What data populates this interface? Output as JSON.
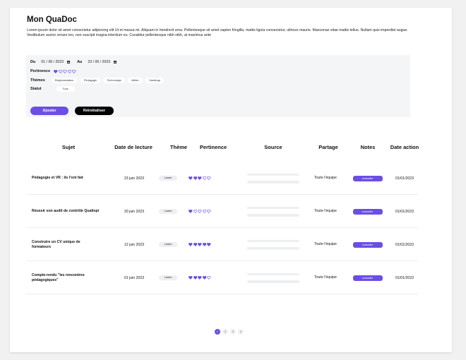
{
  "header": {
    "title": "Mon QuaDoc",
    "description": "Lorem ipsum dolor sit amet consectetur adipiscing elit Ut et massa mi. Aliquam in hendrerit urna. Pellentesque sit amet sapien fringilla, mattis ligula consectetur, ultrices mauris. Maecenas vitae mattis tellus. Nullam quis imperdiet augue. Vestibulum auctor ornare leo, non suscipit magna interdum eu. Curabitur pellentesque nibh nibh, at maximus ante"
  },
  "filters": {
    "from_label": "Du",
    "from_value": "01 / 06 / 2023",
    "to_label": "Au",
    "to_value": "23 / 06 / 2023",
    "pertinence_label": "Pertinence",
    "pertinence_value": 1,
    "themes_label": "Thèmes",
    "themes": [
      "Réglementation",
      "Pédagogie",
      "Technologie",
      "Métier",
      "Handicap"
    ],
    "status_label": "Statut",
    "status_value": "Tous",
    "add_label": "Ajouter",
    "reset_label": "Réinitialiser"
  },
  "table": {
    "columns": [
      "Sujet",
      "Date de lecture",
      "Thème",
      "Pertinence",
      "Source",
      "Partage",
      "Notes",
      "Date action"
    ],
    "rows": [
      {
        "subject": "Pédagogie et VR : ils l'ont fait",
        "date": "23 juin 2023",
        "theme": "Lorem",
        "rating": 3,
        "share": "Toute l'équipe",
        "note": "consulter",
        "action_date": "01/01/2023"
      },
      {
        "subject": "Réussir son audit de contrôle Qualiopi",
        "date": "20 juin 2023",
        "theme": "Lorem",
        "rating": 1,
        "share": "Toute l'équipe",
        "note": "consulter",
        "action_date": "01/01/2023"
      },
      {
        "subject": "Construire un CV unique de formateurs",
        "date": "12 juin 2023",
        "theme": "Lorem",
        "rating": 5,
        "share": "Toute l'équipe",
        "note": "consulter",
        "action_date": "01/01/2023"
      },
      {
        "subject": "Compte-rendu \"les rencontres pédagogiques\"",
        "date": "01 juin 2023",
        "theme": "Lorem",
        "rating": 4,
        "share": "Toute l'équipe",
        "note": "consulter",
        "action_date": "01/01/2023"
      }
    ],
    "max_rating": 5
  },
  "pagination": {
    "pages": [
      "1",
      "2",
      "3",
      "4"
    ],
    "current": "1"
  },
  "colors": {
    "accent": "#6b4ee6",
    "dark_button": "#000000",
    "panel_bg": "#f4f5f7"
  }
}
